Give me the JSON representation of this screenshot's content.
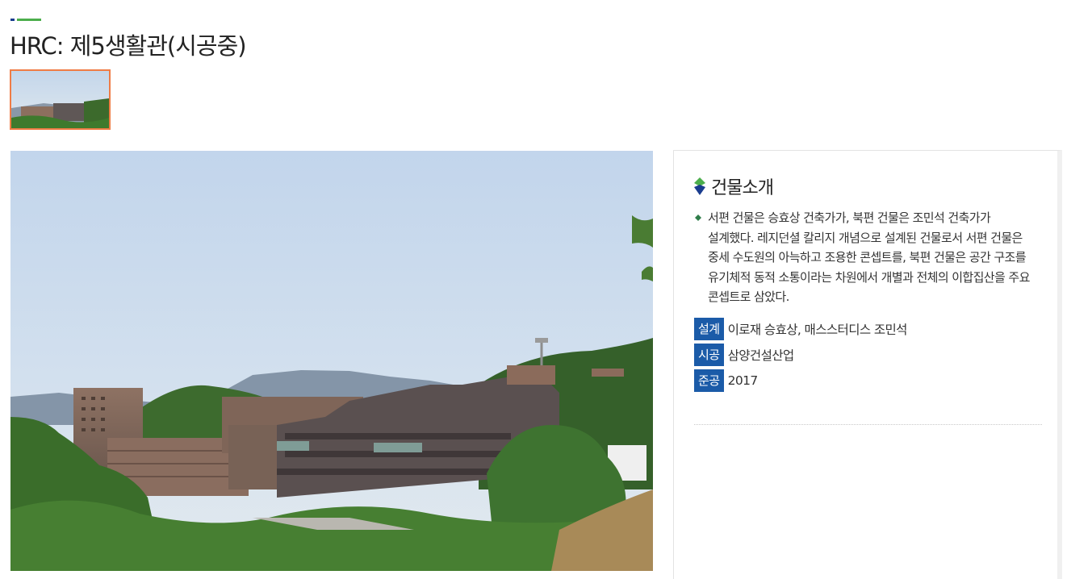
{
  "page": {
    "title": "HRC: 제5생활관(시공중)"
  },
  "gallery": {
    "thumbnail_count": 1,
    "active_index": 0,
    "active_border_color": "#f07c45"
  },
  "info": {
    "heading": "건물소개",
    "description": "서편 건물은 승효상 건축가가, 북편 건물은 조민석 건축가가 설계했다. 레지던셜 칼리지 개념으로 설계된 건물로서 서편 건물은 중세 수도원의 아늑하고 조용한 콘셉트를, 북편 건물은 공간 구조를 유기체적 동적 소통이라는 차원에서 개별과 전체의 이합집산을 주요 콘셉트로 삼았다.",
    "facts": [
      {
        "label": "설계",
        "value": "이로재 승효상, 매스스터디스 조민석"
      },
      {
        "label": "시공",
        "value": "삼양건설산업"
      },
      {
        "label": "준공",
        "value": "2017"
      }
    ]
  },
  "colors": {
    "badge": "#1b5ba8",
    "accent_green": "#4cae4c",
    "accent_blue": "#1a3d8f"
  },
  "icons": {
    "heading": "diamond-icon",
    "bullet": "bullet-diamond-icon"
  }
}
